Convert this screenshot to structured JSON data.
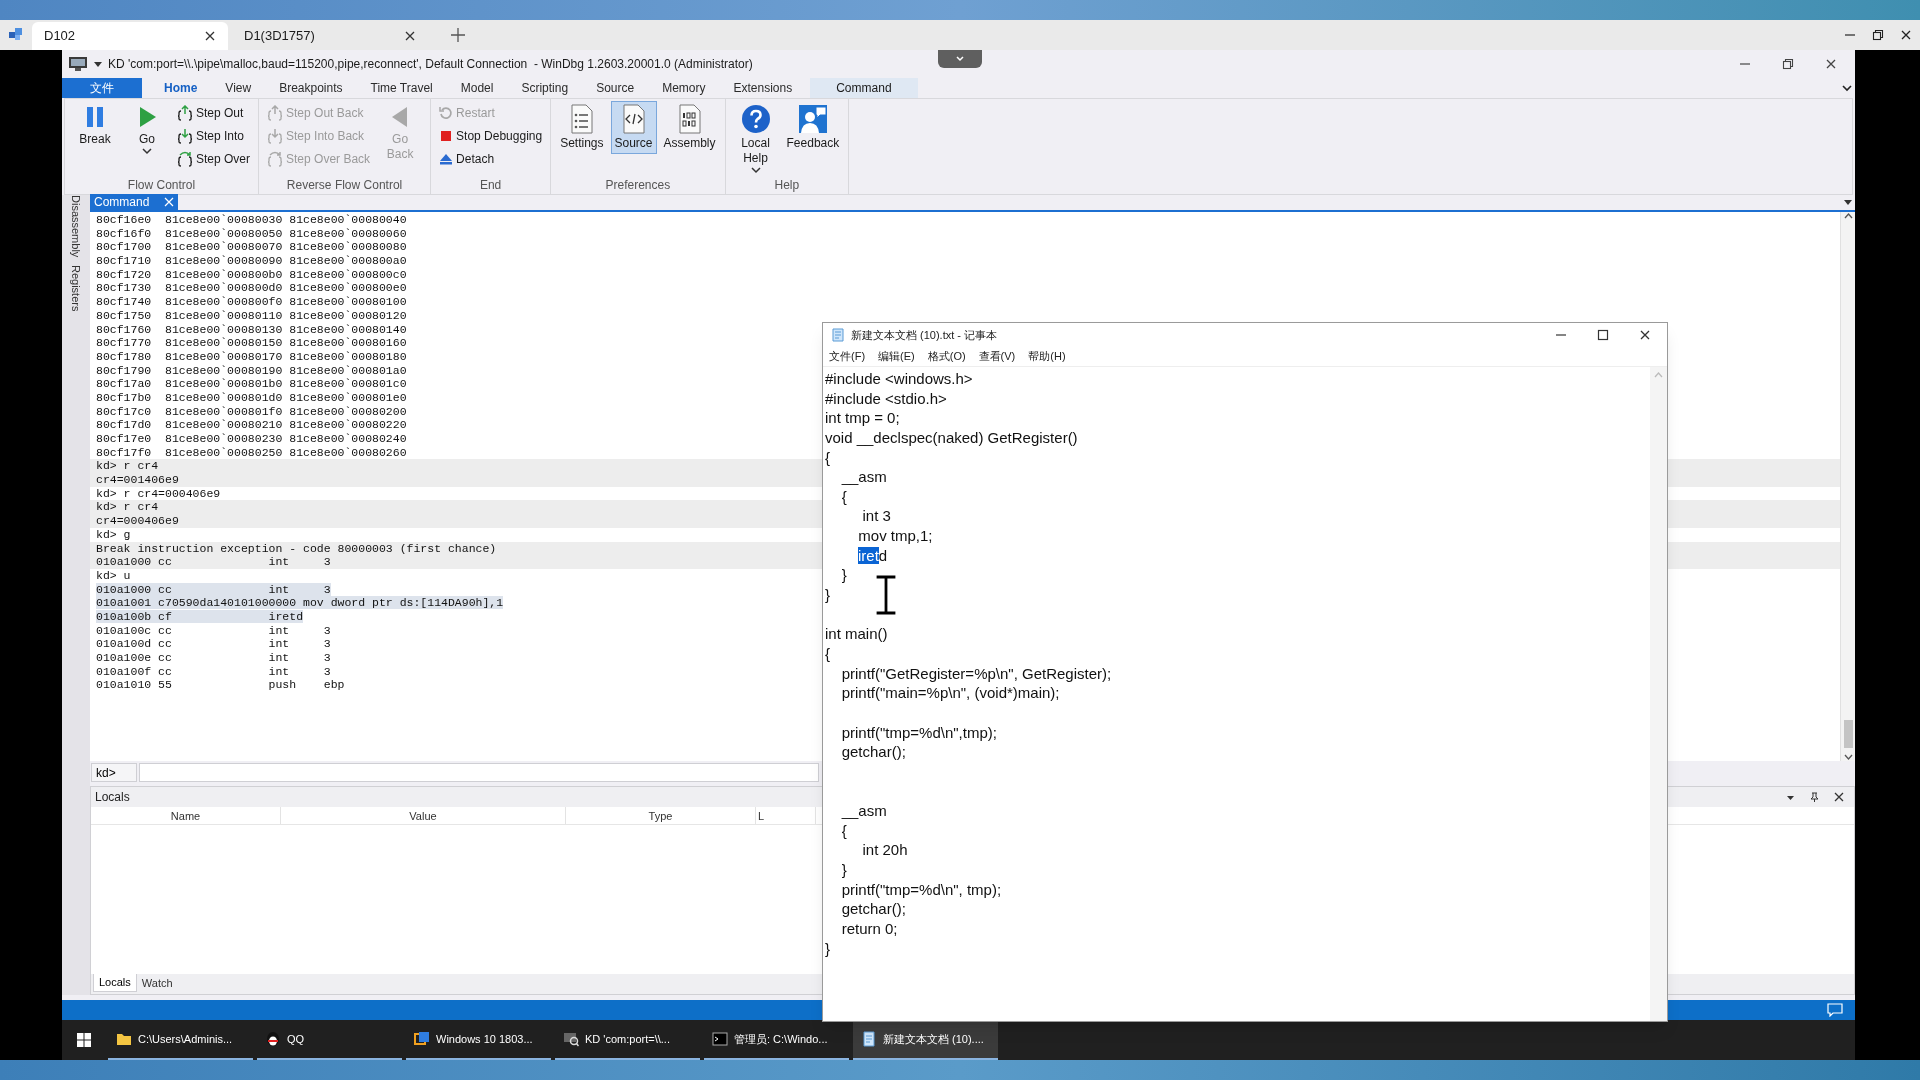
{
  "host_tabs": [
    {
      "label": "D102",
      "selected": true
    },
    {
      "label": "D1(3D1757)",
      "selected": false
    }
  ],
  "windbg": {
    "title": "KD 'com:port=\\\\.\\pipe\\malloc,baud=115200,pipe,reconnect', Default Connection  - WinDbg 1.2603.20001.0 (Administrator)",
    "ribbon_tabs": [
      {
        "label": "文件",
        "kind": "file",
        "selected": false
      },
      {
        "label": "Home",
        "kind": "tab",
        "selected": true
      },
      {
        "label": "View",
        "kind": "tab",
        "selected": false
      },
      {
        "label": "Breakpoints",
        "kind": "tab",
        "selected": false
      },
      {
        "label": "Time Travel",
        "kind": "tab",
        "selected": false
      },
      {
        "label": "Model",
        "kind": "tab",
        "selected": false
      },
      {
        "label": "Scripting",
        "kind": "tab",
        "selected": false
      },
      {
        "label": "Source",
        "kind": "tab",
        "selected": false
      },
      {
        "label": "Memory",
        "kind": "tab",
        "selected": false
      },
      {
        "label": "Extensions",
        "kind": "tab",
        "selected": false
      },
      {
        "label": "Command",
        "kind": "context",
        "selected": false
      }
    ],
    "ribbon_groups": [
      {
        "label": "Flow Control",
        "items": [
          {
            "label": "Break",
            "kind": "break",
            "disabled": false,
            "selected": false,
            "dropdown": false
          },
          {
            "label": "Go",
            "kind": "go",
            "disabled": false,
            "selected": false,
            "dropdown": true
          },
          {
            "label": "Step Out",
            "kind": "step_out",
            "disabled": false,
            "selected": false,
            "dropdown": false
          },
          {
            "label": "Step Into",
            "kind": "step_into",
            "disabled": false,
            "selected": false,
            "dropdown": false
          },
          {
            "label": "Step Over",
            "kind": "step_over",
            "disabled": false,
            "selected": false,
            "dropdown": false
          }
        ]
      },
      {
        "label": "Reverse Flow Control",
        "items": [
          {
            "label": "Step Out Back",
            "kind": "step_out",
            "disabled": true,
            "selected": false,
            "dropdown": false
          },
          {
            "label": "Step Into Back",
            "kind": "step_into",
            "disabled": true,
            "selected": false,
            "dropdown": false
          },
          {
            "label": "Step Over Back",
            "kind": "step_over",
            "disabled": true,
            "selected": false,
            "dropdown": false
          },
          {
            "label": "Go Back",
            "kind": "go_back",
            "disabled": true,
            "selected": false,
            "dropdown": false
          }
        ]
      },
      {
        "label": "End",
        "items": [
          {
            "label": "Restart",
            "kind": "restart",
            "disabled": true,
            "selected": false,
            "dropdown": false
          },
          {
            "label": "Stop Debugging",
            "kind": "stop",
            "disabled": false,
            "selected": false,
            "dropdown": false
          },
          {
            "label": "Detach",
            "kind": "detach",
            "disabled": false,
            "selected": false,
            "dropdown": false
          }
        ]
      },
      {
        "label": "Preferences",
        "items": [
          {
            "label": "Settings",
            "kind": "settings",
            "disabled": false,
            "selected": false,
            "dropdown": false
          },
          {
            "label": "Source",
            "kind": "source",
            "disabled": false,
            "selected": true,
            "dropdown": false
          },
          {
            "label": "Assembly",
            "kind": "assembly",
            "disabled": false,
            "selected": false,
            "dropdown": false
          }
        ]
      },
      {
        "label": "Help",
        "items": [
          {
            "label": "Local Help",
            "kind": "help",
            "disabled": false,
            "selected": false,
            "dropdown": true
          },
          {
            "label": "Feedback",
            "kind": "feedback",
            "disabled": false,
            "selected": false,
            "dropdown": false
          }
        ]
      }
    ],
    "side_tabs": [
      "Disassembly",
      "Registers"
    ],
    "command_tab": "Command",
    "command_lines": [
      {
        "text": "80cf16e0  81ce8e00`00080030 81ce8e00`00080040",
        "shaded": false,
        "selected": false
      },
      {
        "text": "80cf16f0  81ce8e00`00080050 81ce8e00`00080060",
        "shaded": false,
        "selected": false
      },
      {
        "text": "80cf1700  81ce8e00`00080070 81ce8e00`00080080",
        "shaded": false,
        "selected": false
      },
      {
        "text": "80cf1710  81ce8e00`00080090 81ce8e00`000800a0",
        "shaded": false,
        "selected": false
      },
      {
        "text": "80cf1720  81ce8e00`000800b0 81ce8e00`000800c0",
        "shaded": false,
        "selected": false
      },
      {
        "text": "80cf1730  81ce8e00`000800d0 81ce8e00`000800e0",
        "shaded": false,
        "selected": false
      },
      {
        "text": "80cf1740  81ce8e00`000800f0 81ce8e00`00080100",
        "shaded": false,
        "selected": false
      },
      {
        "text": "80cf1750  81ce8e00`00080110 81ce8e00`00080120",
        "shaded": false,
        "selected": false
      },
      {
        "text": "80cf1760  81ce8e00`00080130 81ce8e00`00080140",
        "shaded": false,
        "selected": false
      },
      {
        "text": "80cf1770  81ce8e00`00080150 81ce8e00`00080160",
        "shaded": false,
        "selected": false
      },
      {
        "text": "80cf1780  81ce8e00`00080170 81ce8e00`00080180",
        "shaded": false,
        "selected": false
      },
      {
        "text": "80cf1790  81ce8e00`00080190 81ce8e00`000801a0",
        "shaded": false,
        "selected": false
      },
      {
        "text": "80cf17a0  81ce8e00`000801b0 81ce8e00`000801c0",
        "shaded": false,
        "selected": false
      },
      {
        "text": "80cf17b0  81ce8e00`000801d0 81ce8e00`000801e0",
        "shaded": false,
        "selected": false
      },
      {
        "text": "80cf17c0  81ce8e00`000801f0 81ce8e00`00080200",
        "shaded": false,
        "selected": false
      },
      {
        "text": "80cf17d0  81ce8e00`00080210 81ce8e00`00080220",
        "shaded": false,
        "selected": false
      },
      {
        "text": "80cf17e0  81ce8e00`00080230 81ce8e00`00080240",
        "shaded": false,
        "selected": false
      },
      {
        "text": "80cf17f0  81ce8e00`00080250 81ce8e00`00080260",
        "shaded": false,
        "selected": false
      },
      {
        "text": "kd> r cr4",
        "shaded": true,
        "selected": false
      },
      {
        "text": "cr4=001406e9",
        "shaded": true,
        "selected": false
      },
      {
        "text": "kd> r cr4=000406e9",
        "shaded": false,
        "selected": false
      },
      {
        "text": "kd> r cr4",
        "shaded": true,
        "selected": false
      },
      {
        "text": "cr4=000406e9",
        "shaded": true,
        "selected": false
      },
      {
        "text": "kd> g",
        "shaded": false,
        "selected": false
      },
      {
        "text": "Break instruction exception - code 80000003 (first chance)",
        "shaded": true,
        "selected": false
      },
      {
        "text": "010a1000 cc              int     3",
        "shaded": true,
        "selected": false
      },
      {
        "text": "kd> u",
        "shaded": false,
        "selected": false
      },
      {
        "text": "010a1000 cc              int     3",
        "shaded": false,
        "selected": true
      },
      {
        "text": "010a1001 c70590da140101000000 mov dword ptr ds:[114DA90h],1",
        "shaded": false,
        "selected": true
      },
      {
        "text": "010a100b cf              iretd",
        "shaded": false,
        "selected": true
      },
      {
        "text": "010a100c cc              int     3",
        "shaded": false,
        "selected": false
      },
      {
        "text": "010a100d cc              int     3",
        "shaded": false,
        "selected": false
      },
      {
        "text": "010a100e cc              int     3",
        "shaded": false,
        "selected": false
      },
      {
        "text": "010a100f cc              int     3",
        "shaded": false,
        "selected": false
      },
      {
        "text": "010a1010 55              push    ebp",
        "shaded": false,
        "selected": false
      }
    ],
    "prompt": "kd>",
    "locals": {
      "title": "Locals",
      "columns": [
        "Name",
        "Value",
        "Type",
        "L"
      ],
      "tabs": [
        {
          "label": "Locals",
          "selected": true
        },
        {
          "label": "Watch",
          "selected": false
        }
      ]
    }
  },
  "notepad": {
    "title": "新建文本文档 (10).txt - 记事本",
    "menu": [
      "文件(F)",
      "编辑(E)",
      "格式(O)",
      "查看(V)",
      "帮助(H)"
    ],
    "lines": [
      {
        "kind": "text",
        "text": "#include <windows.h>"
      },
      {
        "kind": "text",
        "text": "#include <stdio.h>"
      },
      {
        "kind": "text",
        "text": "int tmp = 0;"
      },
      {
        "kind": "text",
        "text": "void __declspec(naked) GetRegister()"
      },
      {
        "kind": "text",
        "text": "{"
      },
      {
        "kind": "text",
        "text": "    __asm"
      },
      {
        "kind": "text",
        "text": "    {"
      },
      {
        "kind": "text",
        "text": "         int 3"
      },
      {
        "kind": "text",
        "text": "        mov tmp,1;"
      },
      {
        "kind": "selection",
        "segments": [
          {
            "text": "iret",
            "selected": true
          },
          {
            "text": "d",
            "selected": false
          }
        ]
      },
      {
        "kind": "text",
        "text": "    }"
      },
      {
        "kind": "text",
        "text": "}"
      },
      {
        "kind": "blank"
      },
      {
        "kind": "text",
        "text": "int main()"
      },
      {
        "kind": "text",
        "text": "{"
      },
      {
        "kind": "text",
        "text": "    printf(\"GetRegister=%p\\n\", GetRegister);"
      },
      {
        "kind": "text",
        "text": "    printf(\"main=%p\\n\", (void*)main);"
      },
      {
        "kind": "blank"
      },
      {
        "kind": "text",
        "text": "    printf(\"tmp=%d\\n\",tmp);"
      },
      {
        "kind": "text",
        "text": "    getchar();"
      },
      {
        "kind": "blank"
      },
      {
        "kind": "blank"
      },
      {
        "kind": "text",
        "text": "    __asm"
      },
      {
        "kind": "text",
        "text": "    {"
      },
      {
        "kind": "text",
        "text": "         int 20h"
      },
      {
        "kind": "text",
        "text": "    }"
      },
      {
        "kind": "text",
        "text": "    printf(\"tmp=%d\\n\", tmp);"
      },
      {
        "kind": "text",
        "text": "    getchar();"
      },
      {
        "kind": "text",
        "text": "    return 0;"
      },
      {
        "kind": "text",
        "text": "}"
      }
    ]
  },
  "taskbar": {
    "items": [
      {
        "label": "C:\\Users\\Adminis...",
        "kind": "folder",
        "selected": false
      },
      {
        "label": "QQ",
        "kind": "chat",
        "selected": false
      },
      {
        "label": "Windows 10 1803...",
        "kind": "vm",
        "selected": false
      },
      {
        "label": "KD 'com:port=\\\\...",
        "kind": "debugger",
        "selected": false
      },
      {
        "label": "管理员: C:\\Windo...",
        "kind": "console",
        "selected": false
      },
      {
        "label": "新建文本文档 (10)....",
        "kind": "notepad",
        "selected": true
      }
    ]
  }
}
